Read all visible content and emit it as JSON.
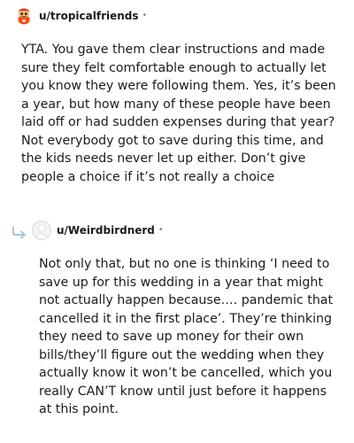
{
  "comments": [
    {
      "username": "u/tropicalfriends",
      "separator": "•",
      "avatar_icon": "snoo-avatar-icon",
      "text": "YTA. You gave them clear instructions and made sure they felt comfortable enough to actually let you know they were following them. Yes, it’s been a year, but how many of these people have been laid off or had sudden expenses during that year? Not everybody got to save during this time, and the kids needs never let up either. Don’t give people a choice if it’s not really a choice"
    },
    {
      "username": "u/Weirdbirdnerd",
      "separator": "•",
      "avatar_icon": "default-avatar-icon",
      "reply_icon": "reply-arrow-icon",
      "text": "Not only that, but no one is thinking ‘I need to save up for this wedding in a year that might not actually happen because…. pandemic that cancelled it in the first place’. They’re thinking they need to save up money for their own bills/they’ll figure out the wedding when they actually know it won’t be cancelled, which you really CAN’T know until just before it happens at this point."
    }
  ],
  "colors": {
    "text": "#1c1c1c",
    "muted": "#878a8c",
    "avatar_orange": "#ff4500",
    "reply_arrow": "#a8c4de"
  }
}
